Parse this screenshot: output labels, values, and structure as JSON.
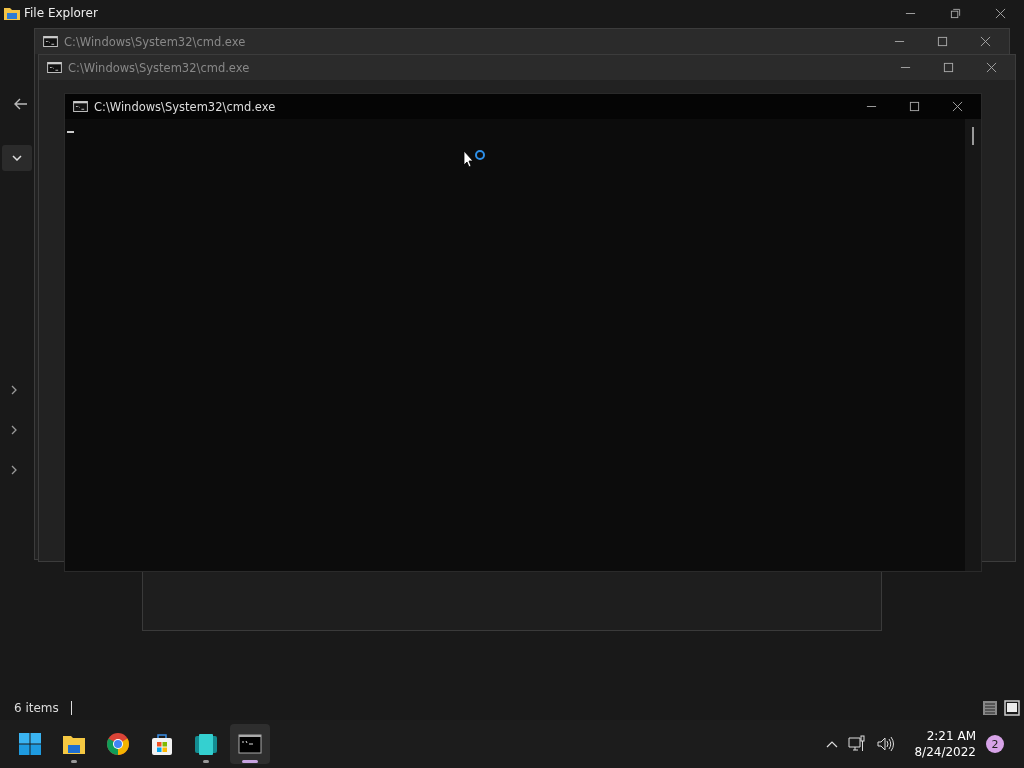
{
  "explorer": {
    "title": "File Explorer",
    "status": "6 items",
    "nav_items": [
      {
        "expanded": false
      },
      {
        "expanded": false
      },
      {
        "expanded": false
      }
    ]
  },
  "cmd_windows": [
    {
      "title": "C:\\Windows\\System32\\cmd.exe",
      "active": false
    },
    {
      "title": "C:\\Windows\\System32\\cmd.exe",
      "active": false
    },
    {
      "title": "C:\\Windows\\System32\\cmd.exe",
      "active": true
    }
  ],
  "taskbar": {
    "apps": [
      {
        "kind": "start",
        "running": false,
        "active": false
      },
      {
        "kind": "explorer",
        "running": true,
        "active": false
      },
      {
        "kind": "chrome",
        "running": false,
        "active": false
      },
      {
        "kind": "store",
        "running": false,
        "active": false
      },
      {
        "kind": "teal",
        "running": true,
        "active": false
      },
      {
        "kind": "terminal",
        "running": true,
        "active": true
      }
    ],
    "time": "2:21 AM",
    "date": "8/24/2022",
    "notifications": "2"
  }
}
